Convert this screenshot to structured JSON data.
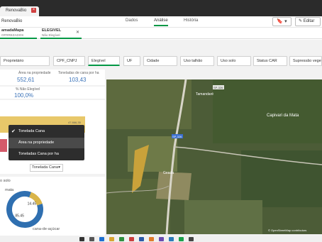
{
  "browser": {
    "tab_title": "RenovaBio",
    "close_glyph": "×"
  },
  "app": {
    "name": "RenovaBio",
    "nav_tabs": [
      "Dados",
      "Análise",
      "História"
    ],
    "active_tab": "Análise",
    "bookmark_glyph": "🔖 ▾",
    "edit_label": "✎ Editar"
  },
  "selections": [
    {
      "name": "amadaMapa",
      "value": "OFRREZADOS"
    },
    {
      "name": "ELEGIVEL",
      "value": "Não Elegível"
    }
  ],
  "filters": [
    "Proprietário",
    "CPF_CNPJ",
    "Elegível",
    "UF",
    "Cidade",
    "Uso talhão",
    "Uso solo",
    "Status CAR",
    "Supressão vegeta"
  ],
  "kpis": {
    "area_label": "Área na propriedade",
    "area_value": "552,61",
    "tonelada_label": "Toneladas de cana por ha",
    "tonelada_value": "103,43",
    "pct_label": "% Não Elegível",
    "pct_value": "100,0%"
  },
  "bar_chart": {
    "top_value_label": "47.866,35"
  },
  "context_menu": {
    "items": [
      "Tonelada Cana",
      "Área na propriedade",
      "Toneladas Cana por ha"
    ],
    "checked_index": 0,
    "highlighted_index": 1,
    "check_glyph": "✔"
  },
  "measure_dropdown": {
    "value": "Tonelada Cana",
    "arrow": "▾"
  },
  "donut": {
    "title": "o solo",
    "labels": [
      "mata",
      "cana-de-açúcar"
    ],
    "values": [
      "14.45",
      "85.45"
    ],
    "colors": [
      "#d9b54a",
      "#2f6fb0"
    ]
  },
  "map": {
    "labels": [
      "Tamandaré",
      "SP-326",
      "Capivari da Mata",
      "SP-326",
      "Geada"
    ],
    "attribution": "© OpenStreetMap contributors"
  }
}
